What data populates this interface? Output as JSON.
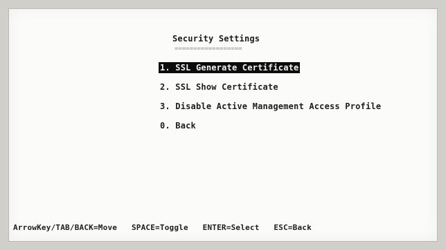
{
  "screen": {
    "title": "Security Settings",
    "title_underline": "=================="
  },
  "menu": {
    "items": [
      {
        "label": "1. SSL Generate Certificate",
        "selected": true
      },
      {
        "label": "2. SSL Show Certificate",
        "selected": false
      },
      {
        "label": "3. Disable Active Management Access Profile",
        "selected": false
      },
      {
        "label": "0. Back",
        "selected": false
      }
    ]
  },
  "status_bar": {
    "move": "ArrowKey/TAB/BACK=Move",
    "toggle": "SPACE=Toggle",
    "select": "ENTER=Select",
    "back": "ESC=Back"
  }
}
